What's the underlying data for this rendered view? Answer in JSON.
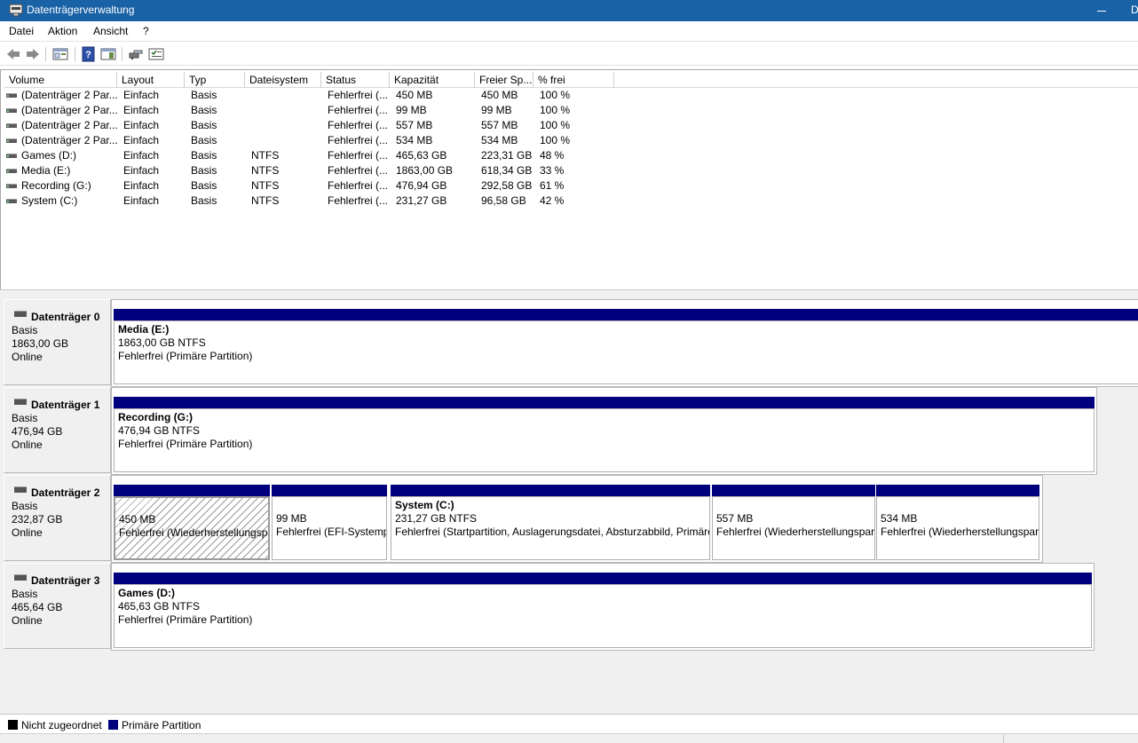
{
  "window": {
    "title": "Datenträgerverwaltung",
    "edge_char": "D"
  },
  "menu": [
    "Datei",
    "Aktion",
    "Ansicht",
    "?"
  ],
  "toolbar": [
    "back-icon",
    "forward-icon",
    "properties-view-icon",
    "help-icon",
    "action-pane-icon",
    "connect-icon",
    "list-icon"
  ],
  "volume_list": {
    "columns": [
      "Volume",
      "Layout",
      "Typ",
      "Dateisystem",
      "Status",
      "Kapazität",
      "Freier Sp...",
      "% frei"
    ],
    "rows": [
      [
        "(Datenträger 2 Par...",
        "Einfach",
        "Basis",
        "",
        "Fehlerfrei (...",
        "450 MB",
        "450 MB",
        "100 %"
      ],
      [
        "(Datenträger 2 Par...",
        "Einfach",
        "Basis",
        "",
        "Fehlerfrei (...",
        "99 MB",
        "99 MB",
        "100 %"
      ],
      [
        "(Datenträger 2 Par...",
        "Einfach",
        "Basis",
        "",
        "Fehlerfrei (...",
        "557 MB",
        "557 MB",
        "100 %"
      ],
      [
        "(Datenträger 2 Par...",
        "Einfach",
        "Basis",
        "",
        "Fehlerfrei (...",
        "534 MB",
        "534 MB",
        "100 %"
      ],
      [
        "Games (D:)",
        "Einfach",
        "Basis",
        "NTFS",
        "Fehlerfrei (...",
        "465,63 GB",
        "223,31 GB",
        "48 %"
      ],
      [
        "Media (E:)",
        "Einfach",
        "Basis",
        "NTFS",
        "Fehlerfrei (...",
        "1863,00 GB",
        "618,34 GB",
        "33 %"
      ],
      [
        "Recording (G:)",
        "Einfach",
        "Basis",
        "NTFS",
        "Fehlerfrei (...",
        "476,94 GB",
        "292,58 GB",
        "61 %"
      ],
      [
        "System (C:)",
        "Einfach",
        "Basis",
        "NTFS",
        "Fehlerfrei (...",
        "231,27 GB",
        "96,58 GB",
        "42 %"
      ]
    ]
  },
  "disks": [
    {
      "name": "Datenträger 0",
      "type": "Basis",
      "size": "1863,00 GB",
      "status": "Online",
      "partitions": [
        {
          "name": "Media  (E:)",
          "size": "1863,00 GB NTFS",
          "status": "Fehlerfrei (Primäre Partition)"
        }
      ]
    },
    {
      "name": "Datenträger 1",
      "type": "Basis",
      "size": "476,94 GB",
      "status": "Online",
      "partitions": [
        {
          "name": "Recording  (G:)",
          "size": "476,94 GB NTFS",
          "status": "Fehlerfrei (Primäre Partition)"
        }
      ]
    },
    {
      "name": "Datenträger 2",
      "type": "Basis",
      "size": "232,87 GB",
      "status": "Online",
      "partitions": [
        {
          "name": "",
          "size": "450 MB",
          "status": "Fehlerfrei (Wiederherstellungspartition)"
        },
        {
          "name": "",
          "size": "99 MB",
          "status": "Fehlerfrei (EFI-Systempartition)"
        },
        {
          "name": "System  (C:)",
          "size": "231,27 GB NTFS",
          "status": "Fehlerfrei (Startpartition, Auslagerungsdatei, Absturzabbild, Primäre Partition)"
        },
        {
          "name": "",
          "size": "557 MB",
          "status": "Fehlerfrei (Wiederherstellungspartition)"
        },
        {
          "name": "",
          "size": "534 MB",
          "status": "Fehlerfrei (Wiederherstellungspartition)"
        }
      ]
    },
    {
      "name": "Datenträger 3",
      "type": "Basis",
      "size": "465,64 GB",
      "status": "Online",
      "partitions": [
        {
          "name": "Games  (D:)",
          "size": "465,63 GB NTFS",
          "status": "Fehlerfrei (Primäre Partition)"
        }
      ]
    }
  ],
  "legend": [
    {
      "label": "Nicht zugeordnet",
      "color": "#000000"
    },
    {
      "label": "Primäre Partition",
      "color": "#00007e"
    }
  ]
}
